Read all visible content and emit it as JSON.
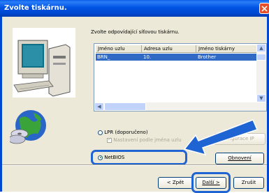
{
  "window": {
    "title": "Zvolte tiskárnu."
  },
  "instruction": "Zvolte odpovídající síťovou tiskárnu.",
  "list": {
    "columns": [
      "Jméno uzlu",
      "Adresa uzlu",
      "Jméno tiskárny"
    ],
    "rows": [
      {
        "node": "BRN_",
        "address": "10.",
        "printer": "Brother"
      }
    ]
  },
  "options": {
    "lpr_label": "LPR (doporučeno)",
    "name_setting_label": "Nastavení podle jména uzlu",
    "netbios_label": "NetBIOS",
    "selected": "NetBIOS"
  },
  "buttons": {
    "config_ip": "nfigurace IP",
    "refresh": "Obnovení",
    "back": "< Zpět",
    "next": "Další >",
    "cancel": "Zrušit"
  },
  "colors": {
    "titlebar": "#0054e3",
    "highlight": "#1e64d2",
    "selection": "#316ac5"
  }
}
